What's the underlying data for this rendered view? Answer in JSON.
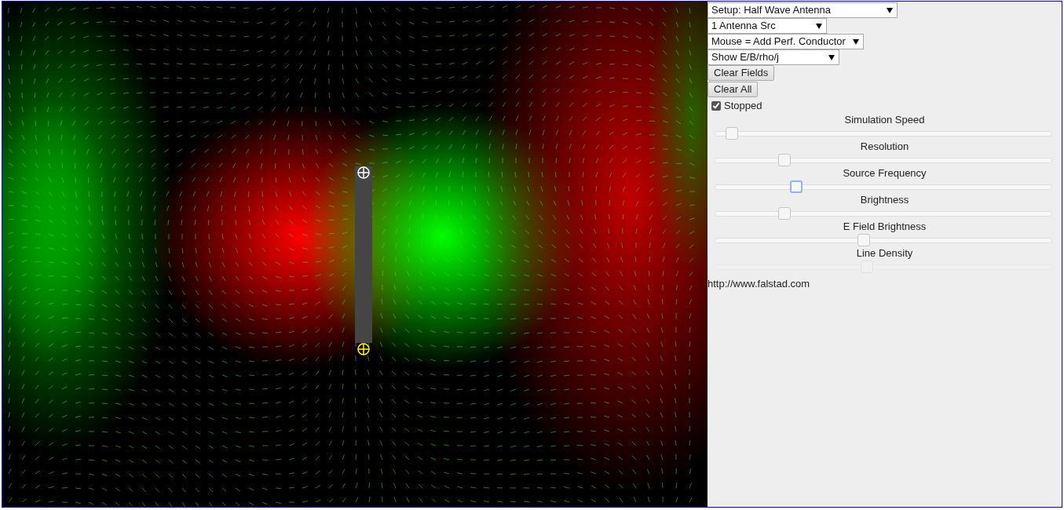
{
  "dropdowns": [
    {
      "value": "Setup: Half Wave Antenna"
    },
    {
      "value": "1 Antenna Src"
    },
    {
      "value": "Mouse = Add Perf. Conductor"
    },
    {
      "value": "Show E/B/rho/j"
    }
  ],
  "buttons": [
    "Clear Fields",
    "Clear All"
  ],
  "checkbox": {
    "label": "Stopped",
    "checked": true
  },
  "sliders": [
    {
      "label": "Simulation Speed",
      "level": 0.035,
      "focused": false,
      "disabled": false
    },
    {
      "label": "Resolution",
      "level": 0.195,
      "focused": false,
      "disabled": false
    },
    {
      "label": "Source Frequency",
      "level": 0.232,
      "focused": true,
      "disabled": false
    },
    {
      "label": "Brightness",
      "level": 0.195,
      "focused": false,
      "disabled": false
    },
    {
      "label": "E Field Brightness",
      "level": 0.44,
      "focused": false,
      "disabled": false
    },
    {
      "label": "Line Density",
      "level": 0.45,
      "focused": false,
      "disabled": true
    }
  ],
  "link": "http://www.falstad.com"
}
